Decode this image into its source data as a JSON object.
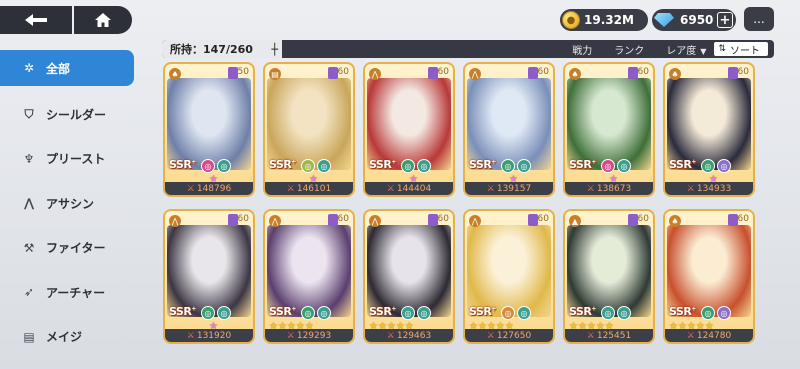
{
  "nav": {
    "back_icon": "back-arrow-icon",
    "home_icon": "home-icon"
  },
  "currency": {
    "gold": "19.32M",
    "gems": "6950",
    "plus_label": "+",
    "chat_icon": "chat-bubble-icon",
    "chat_glyph": "..."
  },
  "sidebar": {
    "items": [
      {
        "label": "全部",
        "icon": "star-outline-icon",
        "glyph": "✲",
        "active": true
      },
      {
        "label": "シールダー",
        "icon": "shield-icon",
        "glyph": "⛉",
        "active": false
      },
      {
        "label": "プリースト",
        "icon": "priest-icon",
        "glyph": "♆",
        "active": false
      },
      {
        "label": "アサシン",
        "icon": "assassin-icon",
        "glyph": "⋀",
        "active": false
      },
      {
        "label": "ファイター",
        "icon": "axe-icon",
        "glyph": "⚒",
        "active": false
      },
      {
        "label": "アーチャー",
        "icon": "bow-icon",
        "glyph": "➶",
        "active": false
      },
      {
        "label": "メイジ",
        "icon": "book-icon",
        "glyph": "▤",
        "active": false
      }
    ]
  },
  "filter": {
    "owned_label": "所持：147/260",
    "power_label": "戦力",
    "rank_label": "ランク",
    "rarity_label": "レア度",
    "sort_label": "ソート"
  },
  "cards": [
    {
      "level": "50",
      "power": "148796",
      "grade": "SSR",
      "cls": "♠",
      "stars": "★",
      "starType": "pink",
      "art": [
        "#dfe6f2",
        "#6e7fa8"
      ],
      "elems": [
        "#d94a8a",
        "#3a9f8f"
      ]
    },
    {
      "level": "60",
      "power": "146101",
      "grade": "SSR",
      "cls": "▤",
      "stars": "★",
      "starType": "pink",
      "art": [
        "#f3e3c2",
        "#c9a65a"
      ],
      "elems": [
        "#9fb84a",
        "#3a9f8f"
      ]
    },
    {
      "level": "60",
      "power": "144404",
      "grade": "SSR",
      "cls": "⋀",
      "stars": "★",
      "starType": "pink",
      "art": [
        "#f4e8e2",
        "#b83838"
      ],
      "elems": [
        "#3a9f6f",
        "#3a9f8f"
      ]
    },
    {
      "level": "60",
      "power": "139157",
      "grade": "SSR",
      "cls": "⋀",
      "stars": "★",
      "starType": "pink",
      "art": [
        "#dfe8f5",
        "#7a8fb8"
      ],
      "elems": [
        "#3a9f6f",
        "#3a9f8f"
      ]
    },
    {
      "level": "60",
      "power": "138673",
      "grade": "SSR",
      "cls": "♠",
      "stars": "★",
      "starType": "pink",
      "art": [
        "#d6e8d0",
        "#3f6f3a"
      ],
      "elems": [
        "#d94a8a",
        "#3a9f8f"
      ]
    },
    {
      "level": "60",
      "power": "134933",
      "grade": "SSR",
      "cls": "♠",
      "stars": "★",
      "starType": "pink",
      "art": [
        "#f4ead8",
        "#2b2b3c"
      ],
      "elems": [
        "#3a9f6f",
        "#8b6fc9"
      ]
    },
    {
      "level": "60",
      "power": "131920",
      "grade": "SSR",
      "cls": "⋀",
      "stars": "★",
      "starType": "pink",
      "art": [
        "#e8e6ea",
        "#3c3644"
      ],
      "elems": [
        "#3a9f6f",
        "#3a9f8f"
      ]
    },
    {
      "level": "60",
      "power": "129293",
      "grade": "SSR",
      "cls": "⋀",
      "stars": "★★★★★",
      "starType": "gold",
      "art": [
        "#ece4ef",
        "#5a3f6f"
      ],
      "elems": [
        "#3a9f6f",
        "#3a9f8f"
      ]
    },
    {
      "level": "60",
      "power": "129463",
      "grade": "SSR",
      "cls": "⋀",
      "stars": "★★★★★",
      "starType": "gold",
      "art": [
        "#e6e4ea",
        "#2e2a34"
      ],
      "elems": [
        "#3a9f8f",
        "#3a9f8f"
      ]
    },
    {
      "level": "60",
      "power": "127650",
      "grade": "SSR",
      "cls": "⋀",
      "stars": "★★★★★",
      "starType": "gold",
      "art": [
        "#fbf1d8",
        "#e0b84a"
      ],
      "elems": [
        "#d98a3a",
        "#3a9f8f"
      ]
    },
    {
      "level": "60",
      "power": "125451",
      "grade": "SSR",
      "cls": "▲",
      "stars": "★★★★★",
      "starType": "gold",
      "art": [
        "#e4ecd8",
        "#2e3a34"
      ],
      "elems": [
        "#3a9f8f",
        "#3a9f8f"
      ]
    },
    {
      "level": "60",
      "power": "124780",
      "grade": "SSR",
      "cls": "♠",
      "stars": "★★★★★",
      "starType": "gold",
      "art": [
        "#fbecd2",
        "#c8502e"
      ],
      "elems": [
        "#3a9f6f",
        "#8b6fc9"
      ]
    }
  ]
}
